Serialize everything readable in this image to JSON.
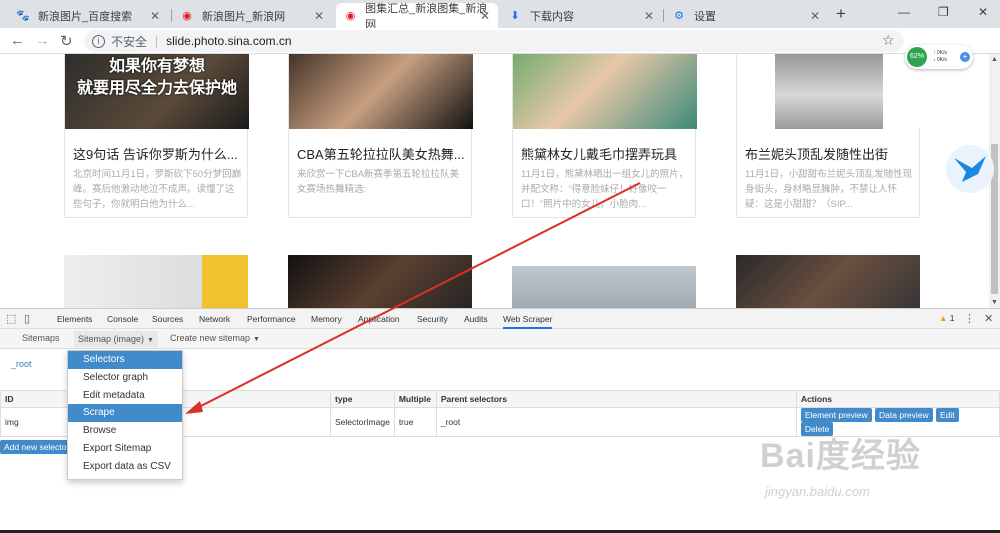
{
  "tabs": [
    {
      "title": "新浪图片_百度搜索",
      "icon": "paw-icon"
    },
    {
      "title": "新浪图片_新浪网",
      "icon": "weibo-icon"
    },
    {
      "title": "图集汇总_新浪图集_新浪网",
      "icon": "weibo-icon",
      "active": true
    },
    {
      "title": "下载内容",
      "icon": "download-icon"
    },
    {
      "title": "设置",
      "icon": "gear-icon"
    }
  ],
  "address": {
    "security": "不安全",
    "url": "slide.photo.sina.com.cn"
  },
  "net_widget": {
    "percent": "62%",
    "up": "0K/s",
    "down": "0K/s"
  },
  "cards": [
    {
      "title": "这9句话 告诉你罗斯为什么...",
      "desc": "北京时间11月1日，罗斯砍下50分梦回巅峰。赛后他激动地泣不成声。读懂了这些句子，你就明白他为什么...",
      "overlay_line1": "如果你有梦想",
      "overlay_line2": "就要用尽全力去保护她"
    },
    {
      "title": "CBA第五轮拉拉队美女热舞...",
      "desc": "来欣赏一下CBA新赛季第五轮拉拉队美女赛场热舞精选:"
    },
    {
      "title": "熊黛林女儿戴毛巾摆弄玩具",
      "desc": "11月1日，熊黛林晒出一组女儿的照片，并配文称：“得意脸妹仔！好像咬一口！”照片中的女儿，小脸肉..."
    },
    {
      "title": "布兰妮头顶乱发随性出街",
      "desc": "11月1日，小甜甜布兰妮头顶乱发随性现身街头，身材略显臃肿，不禁让人怀疑：这是小甜甜？（SIP..."
    }
  ],
  "devtools": {
    "tabs": [
      "Elements",
      "Console",
      "Sources",
      "Network",
      "Performance",
      "Memory",
      "Application",
      "Security",
      "Audits",
      "Web Scraper"
    ],
    "active_tab": "Web Scraper",
    "warning_count": "1"
  },
  "scraper": {
    "nav": [
      "Sitemaps",
      "Sitemap (image)",
      "Create new sitemap"
    ],
    "root_link": "_root",
    "table_headers": [
      "ID",
      "type",
      "Multiple",
      "Parent selectors",
      "Actions"
    ],
    "rows": [
      {
        "id": "img",
        "type": "SelectorImage",
        "multiple": "true",
        "parent": "_root"
      }
    ],
    "actions": [
      "Element preview",
      "Data preview",
      "Edit",
      "Delete"
    ],
    "add_button": "Add new selector",
    "dropdown": [
      "Selectors",
      "Selector graph",
      "Edit metadata",
      "Scrape",
      "Browse",
      "Export Sitemap",
      "Export data as CSV"
    ]
  },
  "watermark": {
    "logo": "Bai度经验",
    "site": "jingyan.baidu.com"
  },
  "colors": {
    "accent": "#428bca",
    "arrow": "#d93025"
  }
}
